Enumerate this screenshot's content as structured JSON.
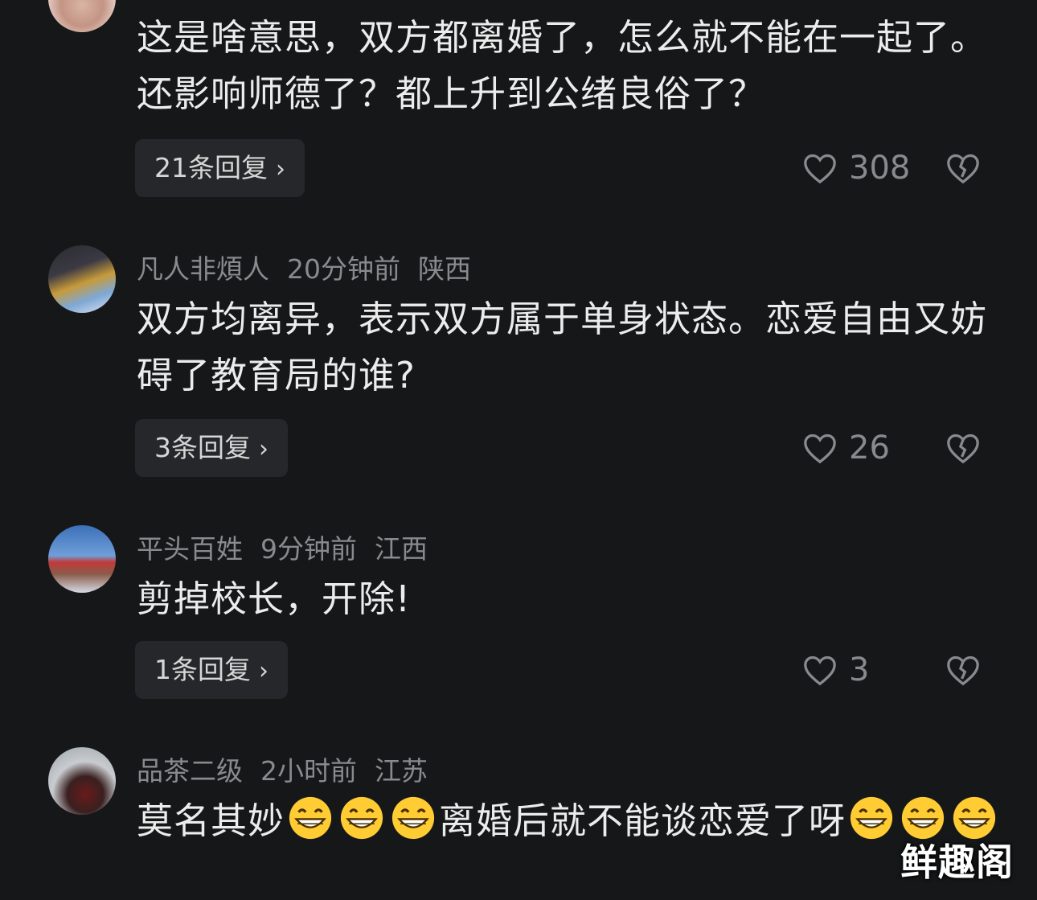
{
  "comments": [
    {
      "text": "这是啥意思，双方都离婚了，怎么就不能在一起了。还影响师德了？都上升到公绪良俗了？",
      "replies_label": "21条回复",
      "likes": "308"
    },
    {
      "author": "凡人非煩人",
      "time": "20分钟前",
      "location": "陕西",
      "text": "双方均离异，表示双方属于单身状态。恋爱自由又妨碍了教育局的谁?",
      "replies_label": "3条回复",
      "likes": "26"
    },
    {
      "author": "平头百姓",
      "time": "9分钟前",
      "location": "江西",
      "text": "剪掉校长，开除!",
      "replies_label": "1条回复",
      "likes": "3"
    },
    {
      "author": "品茶二级",
      "time": "2小时前",
      "location": "江苏",
      "text_a": "莫名其妙",
      "text_b": "离婚后就不能谈恋爱了呀"
    }
  ],
  "watermark": "鲜趣阁",
  "icons": [
    "heart-outline-icon",
    "broken-heart-icon",
    "grin-emoji-icon",
    "chevron-right-icon"
  ],
  "colors": {
    "background": "#161719",
    "text": "#ececec",
    "meta": "#8a8a8e",
    "button": "#26272a"
  }
}
